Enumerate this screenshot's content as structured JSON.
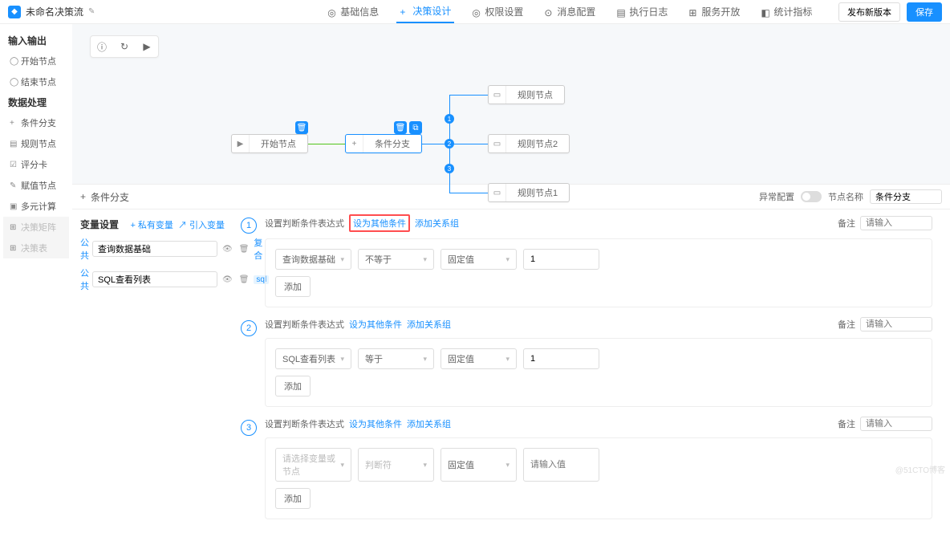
{
  "header": {
    "title": "未命名决策流",
    "edit_icon": "✎",
    "nav": [
      {
        "icon": "◎",
        "label": "基础信息"
      },
      {
        "icon": "+",
        "label": "决策设计",
        "active": true
      },
      {
        "icon": "◎",
        "label": "权限设置"
      },
      {
        "icon": "⊙",
        "label": "消息配置"
      },
      {
        "icon": "▤",
        "label": "执行日志"
      },
      {
        "icon": "⊞",
        "label": "服务开放"
      },
      {
        "icon": "◧",
        "label": "统计指标"
      }
    ],
    "actions": {
      "release": "发布新版本",
      "save": "保存"
    }
  },
  "sidebar": {
    "io_head": "输入输出",
    "io_items": [
      {
        "sym": "◯",
        "label": "开始节点"
      },
      {
        "sym": "◯",
        "label": "结束节点"
      }
    ],
    "proc_head": "数据处理",
    "proc_items": [
      {
        "sym": "+",
        "label": "条件分支"
      },
      {
        "sym": "▤",
        "label": "规则节点"
      },
      {
        "sym": "☑",
        "label": "评分卡"
      },
      {
        "sym": "✎",
        "label": "赋值节点"
      },
      {
        "sym": "▣",
        "label": "多元计算"
      },
      {
        "sym": "⊞",
        "label": "决策矩阵",
        "disabled": true
      },
      {
        "sym": "⊞",
        "label": "决策表",
        "disabled": true
      }
    ]
  },
  "canvas": {
    "tools": [
      "ⓘ",
      "↻",
      "▶"
    ],
    "start": "开始节点",
    "branch": "条件分支",
    "rules": [
      "规则节点",
      "规则节点2",
      "规则节点1"
    ],
    "nums": [
      "1",
      "2",
      "3"
    ]
  },
  "lower": {
    "tab_icon": "+",
    "tab": "条件分支",
    "exception": "异常配置",
    "node_name": "节点名称",
    "node_name_val": "条件分支"
  },
  "vars": {
    "head": "变量设置",
    "private": "+ 私有变量",
    "import": "↗ 引入变量",
    "rows": [
      {
        "scope": "公共",
        "name": "查询数据基础",
        "act": "复合"
      },
      {
        "scope": "公共",
        "name": "SQL查看列表",
        "act": "sql"
      }
    ]
  },
  "conds": [
    {
      "num": "1",
      "label": "设置判断条件表达式",
      "link1": "设为其他条件",
      "link2": "添加关系组",
      "remark": "备注",
      "remark_ph": "请输入",
      "highlight": true,
      "row": {
        "col1": "查询数据基础",
        "col2": "不等于",
        "col3": "固定值",
        "col4": "1"
      },
      "add": "添加"
    },
    {
      "num": "2",
      "label": "设置判断条件表达式",
      "link1": "设为其他条件",
      "link2": "添加关系组",
      "remark": "备注",
      "remark_ph": "请输入",
      "row": {
        "col1": "SQL查看列表",
        "col2": "等于",
        "col3": "固定值",
        "col4": "1"
      },
      "add": "添加"
    },
    {
      "num": "3",
      "label": "设置判断条件表达式",
      "link1": "设为其他条件",
      "link2": "添加关系组",
      "remark": "备注",
      "remark_ph": "请输入",
      "row": {
        "col1_ph": "请选择变量或节点",
        "col2_ph": "判断符",
        "col3": "固定值",
        "col4_ph": "请输入值"
      },
      "add": "添加"
    }
  ],
  "watermark": "@51CTO博客"
}
